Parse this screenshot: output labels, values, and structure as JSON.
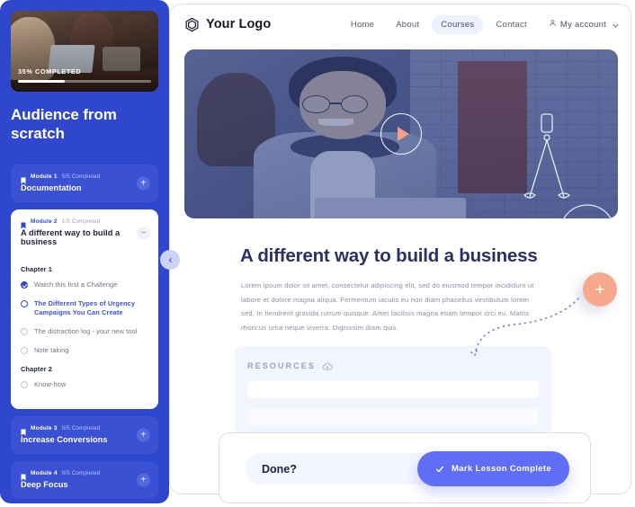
{
  "colors": {
    "sidebar_blue": "#2f47cc",
    "accent_blue": "#5f6ef5",
    "accent_coral": "#f7a98e",
    "title_navy": "#2b3166"
  },
  "nav": {
    "brand": "Your Logo",
    "links": [
      {
        "label": "Home",
        "active": false
      },
      {
        "label": "About",
        "active": false
      },
      {
        "label": "Courses",
        "active": true
      },
      {
        "label": "Contact",
        "active": false
      }
    ],
    "account": "My account"
  },
  "hero": {
    "play_label": "Play"
  },
  "lesson": {
    "title": "A different way to build a business",
    "body": "Lorem ipsum dolor sit amet, consectetur adipiscing elit, sed do eiusmod tempor incididunt ut labore et dolore magna aliqua. Fermentum iaculis eu non diam phasellus vestibulum lorem sed. In hendrerit gravida rutrum quisque. Amet facilisis magna etiam tempor orci eu. Mattis rhoncus urna neque viverra. Dignissim diam quis."
  },
  "resources": {
    "title": "RESOURCES",
    "rows": 2
  },
  "fab": {
    "label": "+"
  },
  "done_bar": {
    "question": "Done?",
    "button": "Mark Lesson Complete"
  },
  "sidebar": {
    "progress": {
      "label": "35% COMPLETED",
      "percent": 35
    },
    "course_title": "Audience from scratch",
    "modules": [
      {
        "number": "Module 1",
        "count": "5/5 Completed",
        "name": "Documentation",
        "open": false,
        "toggle": "+"
      },
      {
        "number": "Module 2",
        "count": "1/5 Completed",
        "name": "A different way to build a business",
        "open": true,
        "toggle": "−",
        "chapters": [
          {
            "title": "Chapter 1",
            "lessons": [
              {
                "text": "Watch this first a Challenge",
                "state": "done"
              },
              {
                "text": "The Different Types of Urgency Campaigns You Can Create",
                "state": "active"
              },
              {
                "text": "The distraction log - your new tool",
                "state": "todo"
              },
              {
                "text": "Note taking",
                "state": "todo"
              }
            ]
          },
          {
            "title": "Chapter 2",
            "lessons": [
              {
                "text": "Know-how",
                "state": "todo"
              }
            ]
          }
        ]
      },
      {
        "number": "Module 3",
        "count": "0/5 Completed",
        "name": "Increase Conversions",
        "open": false,
        "toggle": "+"
      },
      {
        "number": "Module 4",
        "count": "0/5 Completed",
        "name": "Deep Focus",
        "open": false,
        "toggle": "+"
      }
    ]
  }
}
